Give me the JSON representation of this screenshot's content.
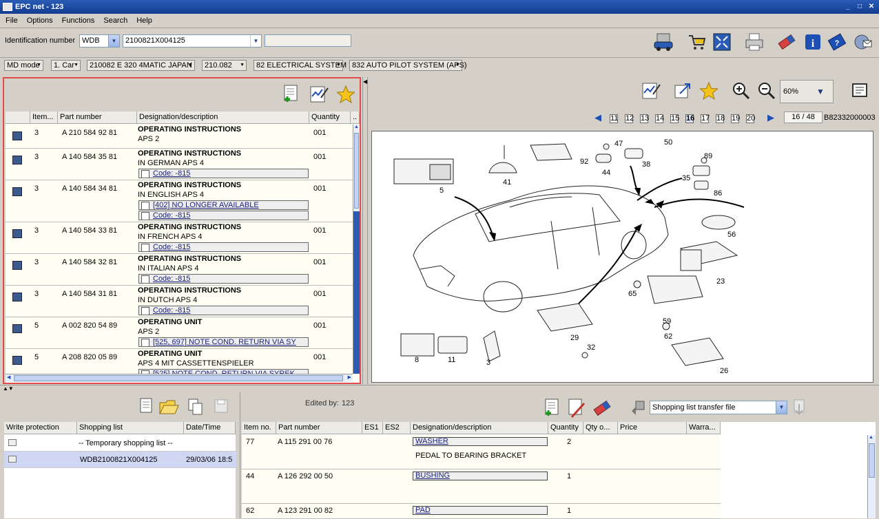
{
  "window": {
    "title": "EPC net - 123"
  },
  "menu": [
    "File",
    "Options",
    "Functions",
    "Search",
    "Help"
  ],
  "ident": {
    "label": "Identification number",
    "prefix": "WDB",
    "vin": "2100821X004125",
    "extra": ""
  },
  "nav": {
    "mode": "MD mode",
    "car": "1. Car",
    "model": "210082 E 320  4MATIC JAPAN",
    "type": "210.082",
    "group": "82 ELECTRICAL SYSTEM",
    "subgroup": "832 AUTO PILOT SYSTEM (APS)"
  },
  "parts_table": {
    "headers": [
      "Item...",
      "Part number",
      "Designation/description",
      "Quantity",
      ".."
    ],
    "rows": [
      {
        "item": "3",
        "part": "A 210 584 92 81",
        "d1": "OPERATING INSTRUCTIONS",
        "d2": "APS 2",
        "qty": "001",
        "notes": []
      },
      {
        "item": "3",
        "part": "A 140 584 35 81",
        "d1": "OPERATING INSTRUCTIONS",
        "d2": "IN GERMAN APS 4",
        "qty": "001",
        "notes": [
          "Code: -815"
        ]
      },
      {
        "item": "3",
        "part": "A 140 584 34 81",
        "d1": "OPERATING INSTRUCTIONS",
        "d2": "IN ENGLISH APS 4",
        "qty": "001",
        "notes": [
          "[402] NO LONGER AVAILABLE",
          "Code: -815"
        ]
      },
      {
        "item": "3",
        "part": "A 140 584 33 81",
        "d1": "OPERATING INSTRUCTIONS",
        "d2": "IN FRENCH APS 4",
        "qty": "001",
        "notes": [
          "Code: -815"
        ]
      },
      {
        "item": "3",
        "part": "A 140 584 32 81",
        "d1": "OPERATING INSTRUCTIONS",
        "d2": "IN ITALIAN APS 4",
        "qty": "001",
        "notes": [
          "Code: -815"
        ]
      },
      {
        "item": "3",
        "part": "A 140 584 31 81",
        "d1": "OPERATING INSTRUCTIONS",
        "d2": "IN DUTCH APS 4",
        "qty": "001",
        "notes": [
          "Code: -815"
        ]
      },
      {
        "item": "5",
        "part": "A 002 820 54 89",
        "d1": "OPERATING UNIT",
        "d2": "APS 2",
        "qty": "001",
        "notes": [
          "[525, 697] NOTE COND. RETURN VIA SY"
        ]
      },
      {
        "item": "5",
        "part": "A 208 820 05 89",
        "d1": "OPERATING UNIT",
        "d2": "APS 4 MIT CASSETTENSPIELER",
        "qty": "001",
        "notes": [
          "[525] NOTE COND. RETURN VIA SYREK"
        ]
      }
    ]
  },
  "image_nav": {
    "zoom": "60%",
    "pages": [
      "11",
      "12",
      "13",
      "14",
      "15",
      "16",
      "17",
      "18",
      "19",
      "20"
    ],
    "current_page": "16",
    "page_counter": "16 / 48",
    "image_id": "B82332000003"
  },
  "diagram_labels": [
    "5",
    "41",
    "92",
    "47",
    "38",
    "50",
    "44",
    "89",
    "35",
    "86",
    "56",
    "23",
    "65",
    "59",
    "62",
    "29",
    "32",
    "8",
    "11",
    "3",
    "26"
  ],
  "shopping": {
    "headers": [
      "Write protection",
      "Shopping list",
      "Date/Time"
    ],
    "rows": [
      {
        "list": "-- Temporary shopping list --",
        "date": ""
      },
      {
        "list": "WDB2100821X004125",
        "date": "29/03/06 18:5"
      }
    ]
  },
  "basket": {
    "edited_label": "Edited by:",
    "edited_by": "123",
    "transfer": "Shopping list transfer file",
    "headers": [
      "Item no.",
      "Part number",
      "ES1",
      "ES2",
      "Designation/description",
      "Quantity",
      "Qty o...",
      "Price",
      "Warra..."
    ],
    "rows": [
      {
        "item": "77",
        "part": "A 115 291 00 76",
        "desc": "WASHER",
        "desc2": "PEDAL TO BEARING BRACKET",
        "qty": "2"
      },
      {
        "item": "44",
        "part": "A 126 292 00 50",
        "desc": "BUSHING",
        "desc2": "",
        "qty": "1"
      },
      {
        "item": "62",
        "part": "A 123 291 00 82",
        "desc": "PAD",
        "desc2": "",
        "qty": "1"
      }
    ]
  }
}
